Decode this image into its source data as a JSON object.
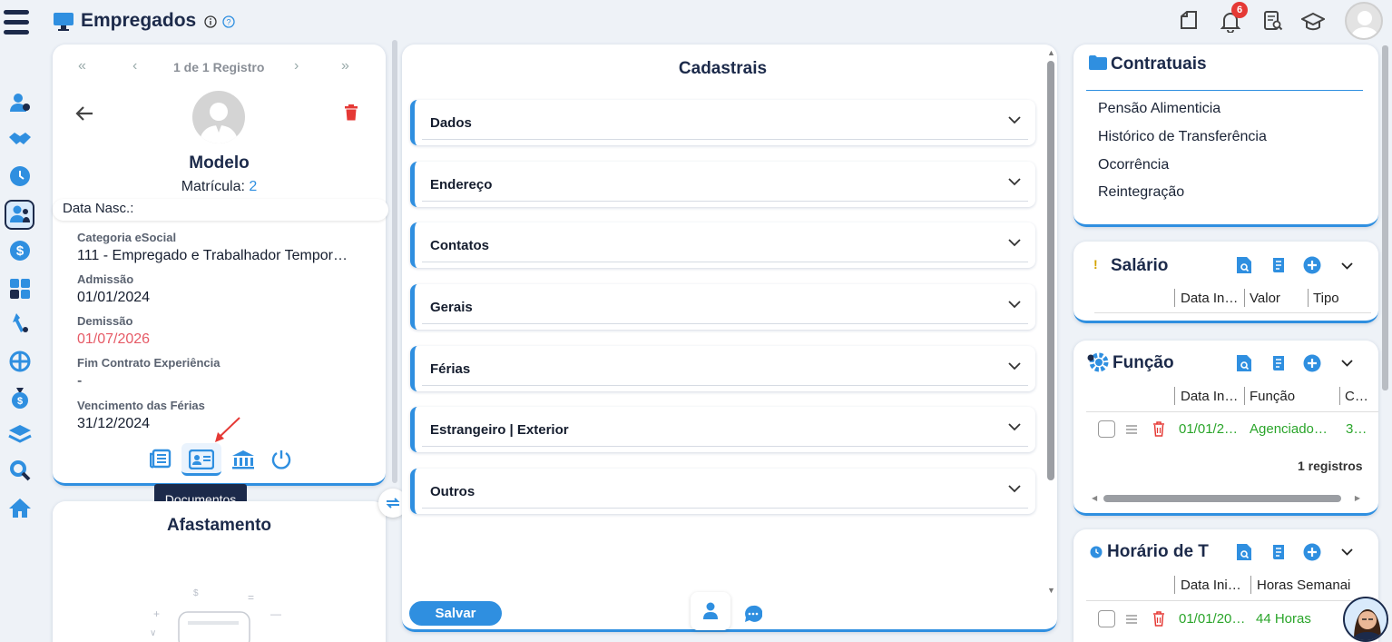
{
  "header": {
    "title": "Empregados",
    "notification_count": "6"
  },
  "pager": {
    "label": "1 de 1 Registro"
  },
  "employee": {
    "name": "Modelo",
    "matricula_label": "Matrícula:",
    "matricula_value": "2",
    "birth_label": "Data Nasc.:",
    "fields": [
      {
        "label": "Categoria eSocial",
        "value": "111 - Empregado e Trabalhador Tempor…"
      },
      {
        "label": "Admissão",
        "value": "01/01/2024"
      },
      {
        "label": "Demissão",
        "value": "01/07/2026"
      },
      {
        "label": "Fim Contrato Experiência",
        "value": "-"
      },
      {
        "label": "Vencimento das Férias",
        "value": "31/12/2024"
      }
    ],
    "tooltip": "Documentos"
  },
  "afastamento": {
    "title": "Afastamento"
  },
  "cadastrais": {
    "title": "Cadastrais",
    "sections": [
      "Dados",
      "Endereço",
      "Contatos",
      "Gerais",
      "Férias",
      "Estrangeiro | Exterior",
      "Outros"
    ],
    "save_label": "Salvar"
  },
  "contratuais": {
    "title": "Contratuais",
    "links": [
      "Pensão Alimenticia",
      "Histórico de Transferência",
      "Ocorrência",
      "Reintegração"
    ]
  },
  "salario": {
    "title": "Salário",
    "columns": [
      "Data In…",
      "Valor",
      "Tipo"
    ]
  },
  "funcao": {
    "title": "Função",
    "columns": [
      "Data In…",
      "Função",
      "C…"
    ],
    "row": {
      "date": "01/01/2…",
      "funcao": "Agenciado…",
      "extra": "3…"
    },
    "count": "1 registros"
  },
  "horario": {
    "title": "Horário de T",
    "columns": [
      "Data Ini…",
      "Horas Semanai"
    ],
    "row": {
      "date": "01/01/20…",
      "hours": "44 Horas"
    }
  },
  "colors": {
    "accent": "#2f8fe0",
    "navy": "#1c2a4a",
    "danger": "#e53935",
    "success": "#2aa52a",
    "red_text": "#e65a66"
  }
}
